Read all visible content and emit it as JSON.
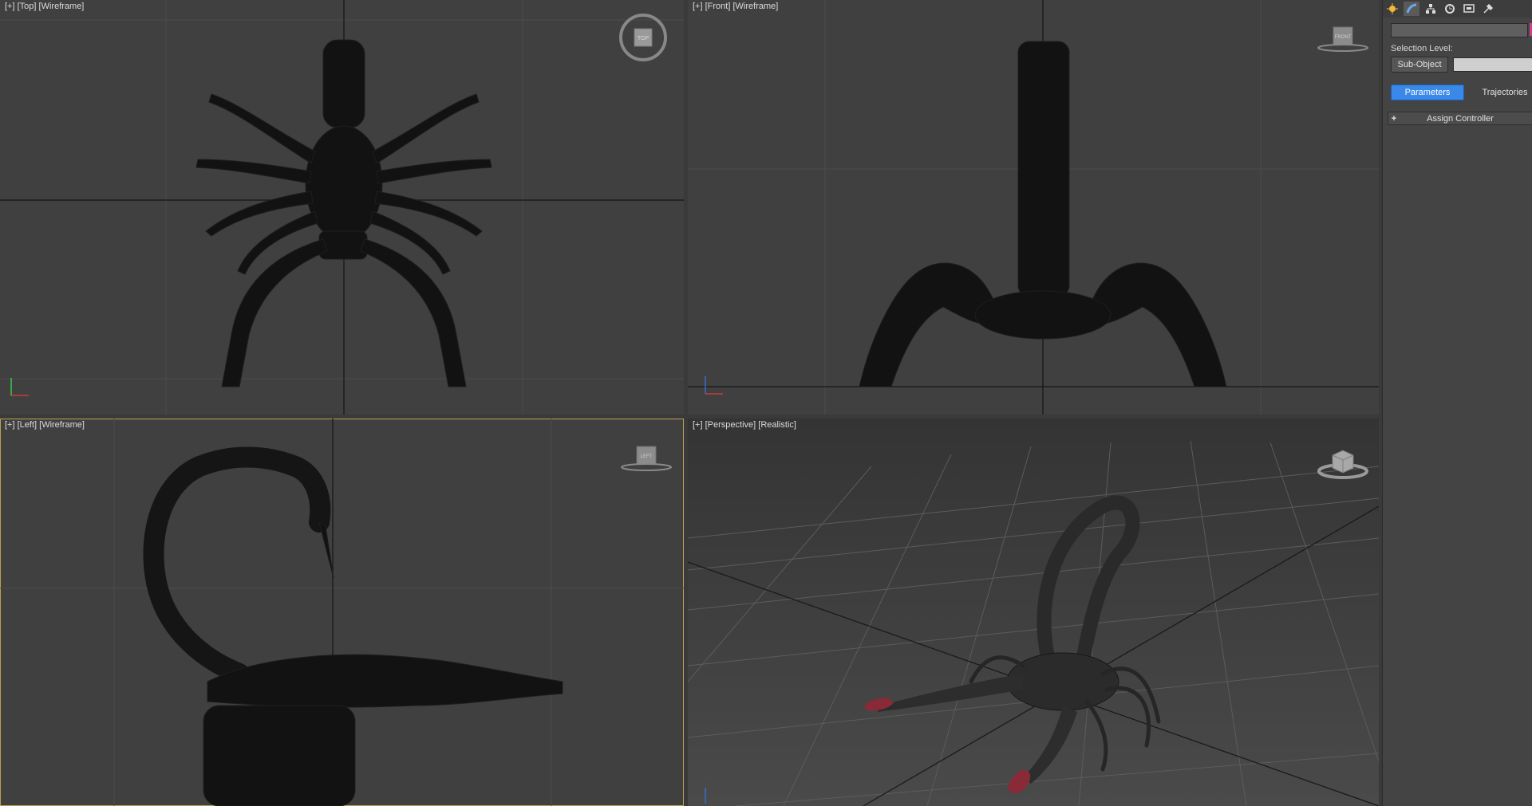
{
  "viewports": {
    "top": {
      "plus": "[+]",
      "view": "[Top]",
      "shading": "[Wireframe]",
      "cube_label": "TOP"
    },
    "front": {
      "plus": "[+]",
      "view": "[Front]",
      "shading": "[Wireframe]",
      "cube_label": "FRONT"
    },
    "left": {
      "plus": "[+]",
      "view": "[Left]",
      "shading": "[Wireframe]",
      "cube_label": "LEFT"
    },
    "perspective": {
      "plus": "[+]",
      "view": "[Perspective]",
      "shading": "[Realistic]"
    }
  },
  "command_panel": {
    "tabs": [
      {
        "name": "create",
        "icon": "create-icon",
        "color": "#f4b73a"
      },
      {
        "name": "modify",
        "icon": "modify-icon",
        "color": "#6aa6e8"
      },
      {
        "name": "hierarchy",
        "icon": "hierarchy-icon",
        "color": "#dddddd"
      },
      {
        "name": "motion",
        "icon": "motion-icon",
        "color": "#dddddd"
      },
      {
        "name": "display",
        "icon": "display-icon",
        "color": "#dddddd"
      },
      {
        "name": "utilities",
        "icon": "utilities-icon",
        "color": "#dddddd"
      }
    ],
    "selection_level_label": "Selection Level:",
    "sub_object_button": "Sub-Object",
    "parameters_button": "Parameters",
    "trajectories_button": "Trajectories",
    "rollout_plus": "+",
    "rollout_title": "Assign Controller",
    "colors": {
      "accent": "#3a88e8",
      "object_color": "#d63c8c",
      "active_viewport_border": "#b9a250"
    }
  }
}
